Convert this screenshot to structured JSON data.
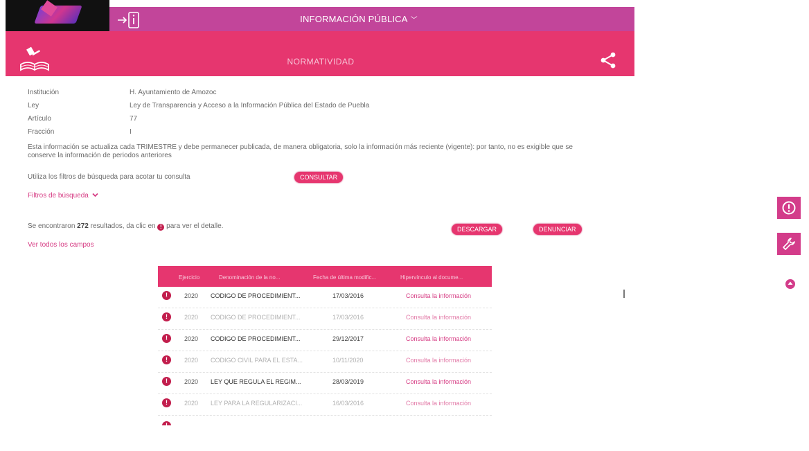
{
  "header": {
    "title": "INFORMACIÓN PÚBLICA",
    "section": "NORMATIVIDAD"
  },
  "meta": [
    {
      "label": "Institución",
      "value": "H. Ayuntamiento de Amozoc"
    },
    {
      "label": "Ley",
      "value": "Ley de Transparencia y Acceso a la Información Pública del Estado de Puebla"
    },
    {
      "label": "Artículo",
      "value": "77"
    },
    {
      "label": "Fracción",
      "value": "I"
    }
  ],
  "notice": "Esta información se actualiza cada TRIMESTRE y debe permanecer publicada, de manera obligatoria, solo la información más reciente (vigente): por tanto, no es exigible que se conserve la información de periodos anteriores",
  "search": {
    "hint": "Utiliza los filtros de búsqueda para acotar tu consulta",
    "consultar": "CONSULTAR",
    "filters_label": "Filtros de búsqueda"
  },
  "results": {
    "prefix": "Se encontraron",
    "count": "272",
    "mid": "resultados, da clic en",
    "suffix": "para ver el detalle.",
    "descargar": "DESCARGAR",
    "denunciar": "DENUNCIAR",
    "all_fields": "Ver todos los campos"
  },
  "table": {
    "headers": [
      "Ejercicio",
      "Denominación de la no...",
      "Fecha de última modific...",
      "Hipervínculo al docume..."
    ],
    "rows": [
      {
        "year": "2020",
        "name": "CODIGO DE PROCEDIMIENT...",
        "date": "17/03/2016",
        "link": "Consulta la información"
      },
      {
        "year": "2020",
        "name": "CODIGO DE PROCEDIMIENT...",
        "date": "17/03/2016",
        "link": "Consulta la información"
      },
      {
        "year": "2020",
        "name": "CODIGO DE PROCEDIMIENT...",
        "date": "29/12/2017",
        "link": "Consulta la información"
      },
      {
        "year": "2020",
        "name": "CODIGO CIVIL PARA EL ESTA...",
        "date": "10/11/2020",
        "link": "Consulta la información"
      },
      {
        "year": "2020",
        "name": "LEY QUE REGULA EL REGIM...",
        "date": "28/03/2019",
        "link": "Consulta la información"
      },
      {
        "year": "2020",
        "name": "LEY PARA LA REGULARIZACI...",
        "date": "16/03/2016",
        "link": "Consulta la información"
      }
    ]
  },
  "colors": {
    "primary": "#c2459a",
    "accent": "#e6366f",
    "link": "#d63b83",
    "icon": "#c21e4d"
  }
}
